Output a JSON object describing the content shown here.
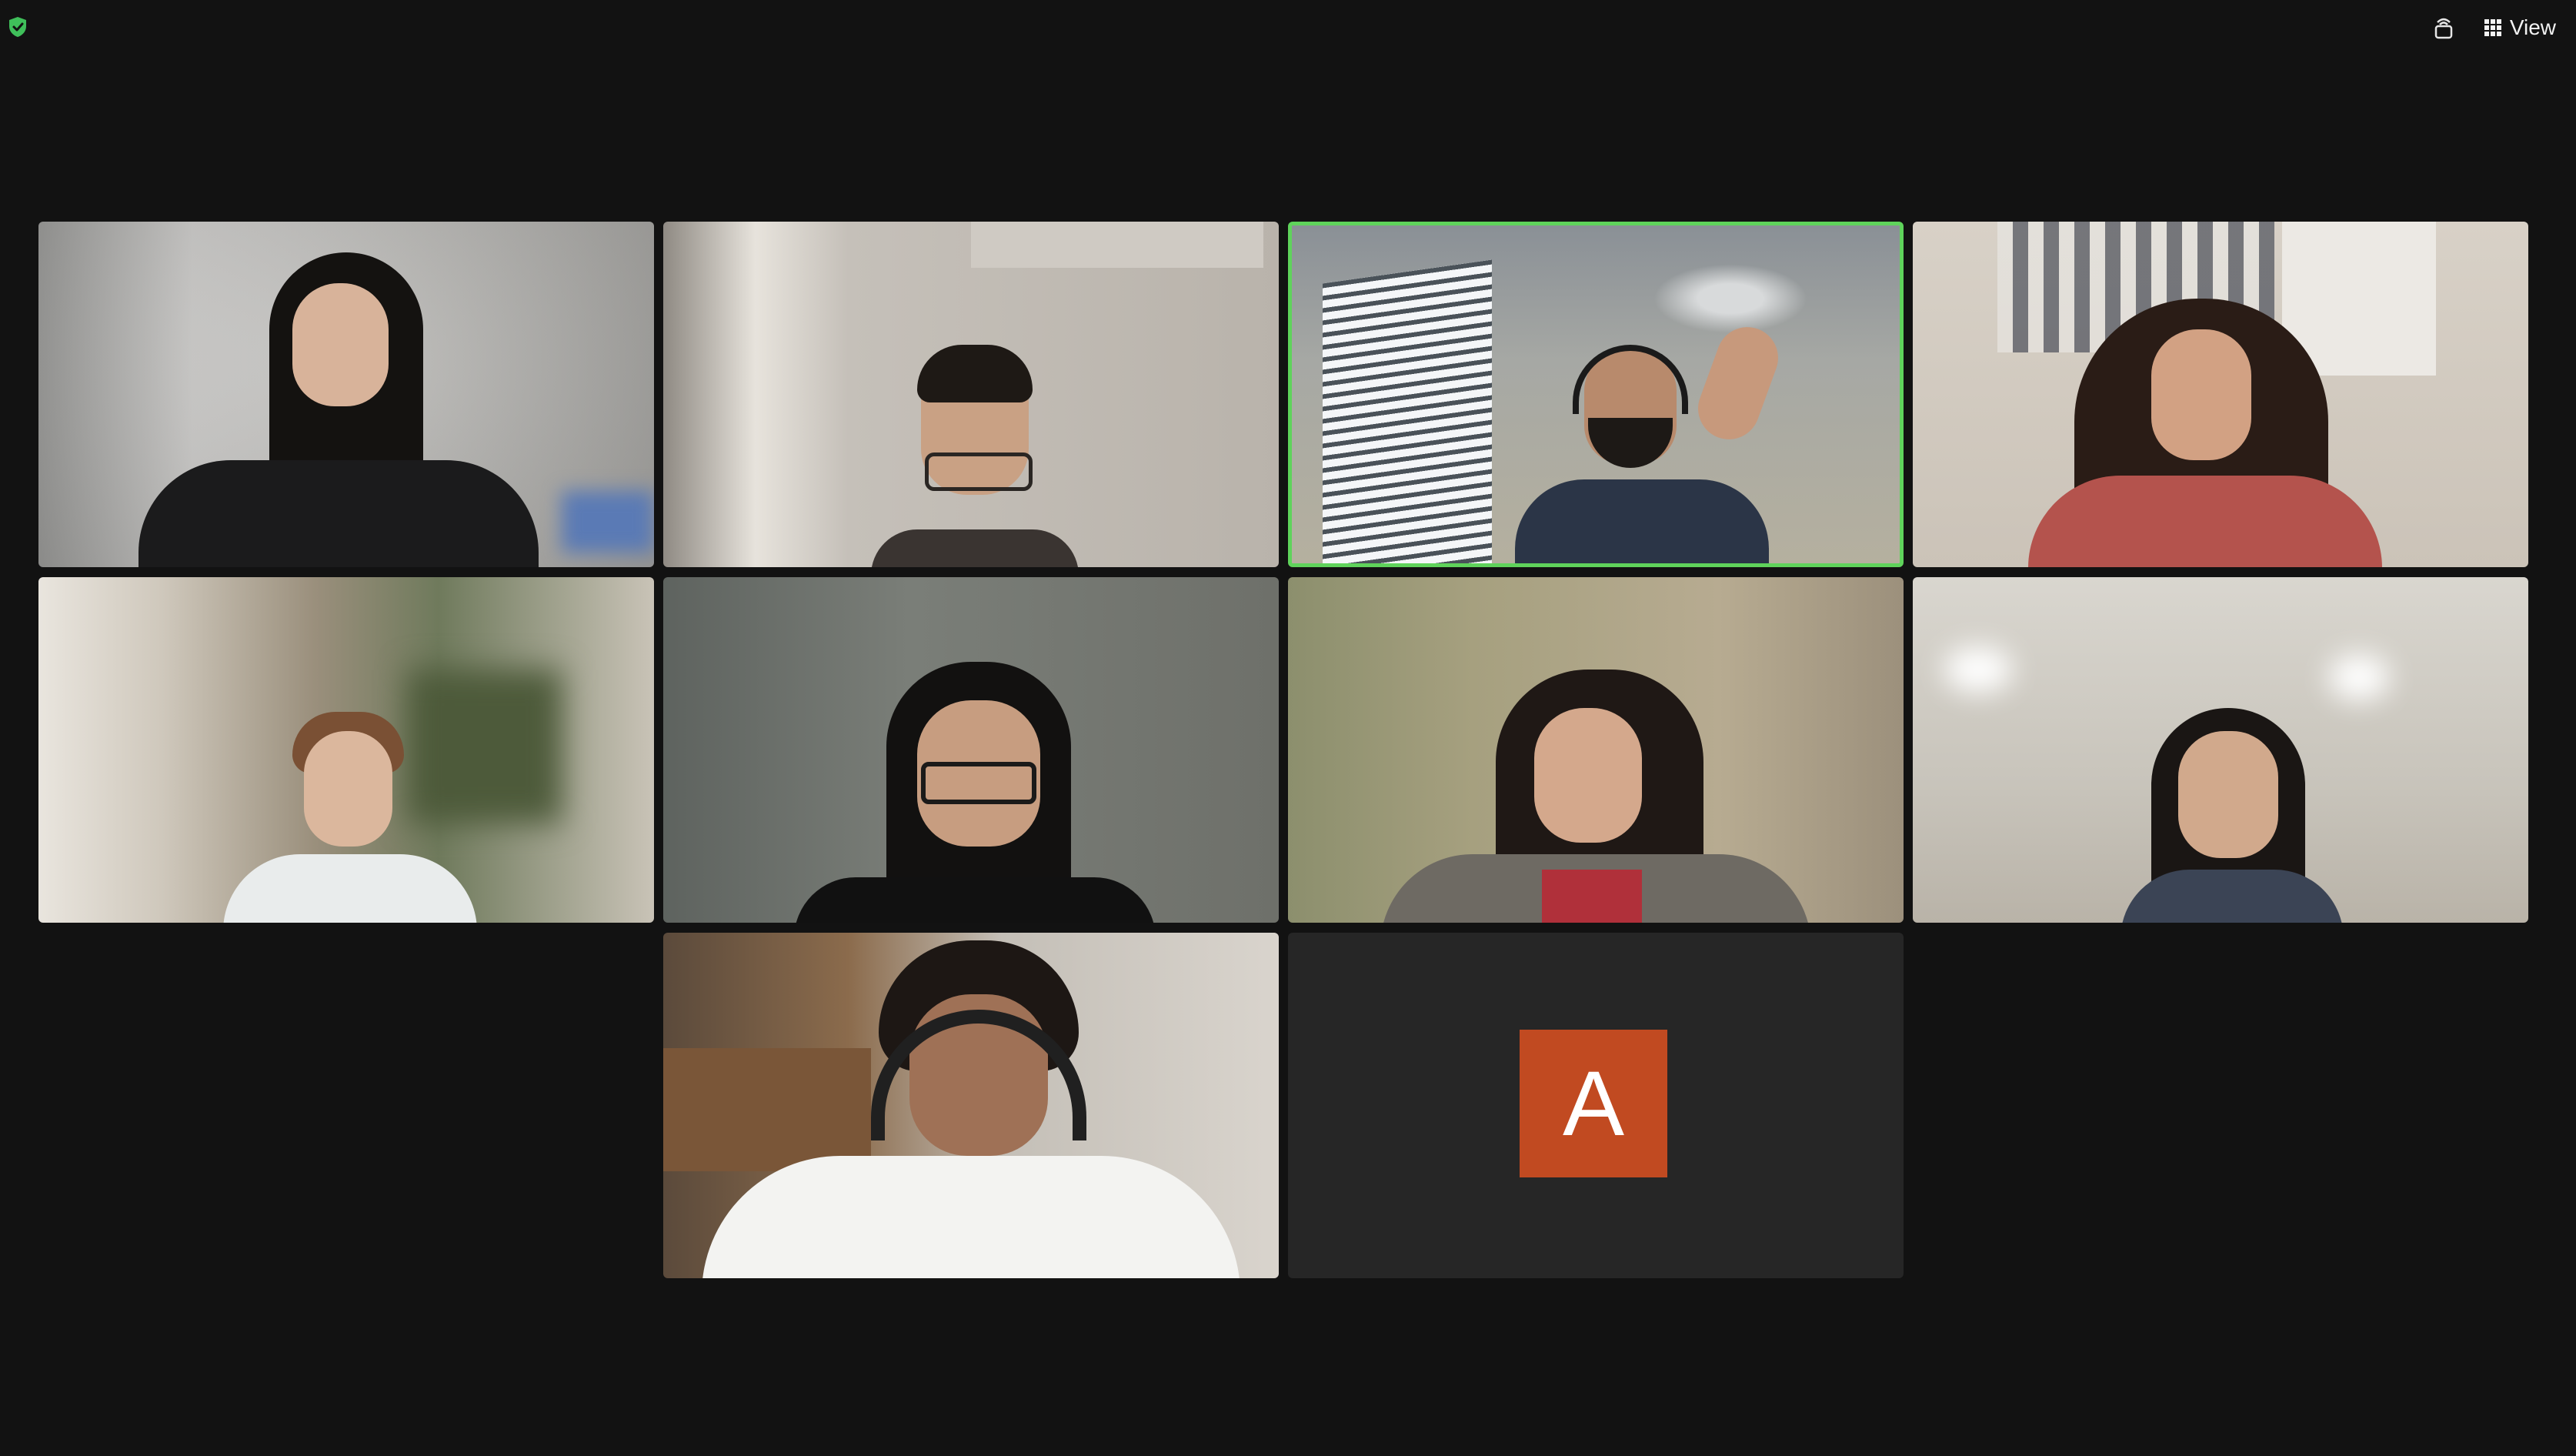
{
  "window": {
    "view_label": "View",
    "icons": {
      "security": "shield-check-icon",
      "immersive": "immersive-view-icon",
      "view": "grid-icon"
    },
    "colors": {
      "background": "#121212",
      "speaker_border": "#5fd35b",
      "avatar_bg": "#c14a21"
    }
  },
  "participants": [
    {
      "id": "p1",
      "video": true
    },
    {
      "id": "p2",
      "video": true
    },
    {
      "id": "p3",
      "video": true,
      "active_speaker": true
    },
    {
      "id": "p4",
      "video": true
    },
    {
      "id": "p5",
      "video": true
    },
    {
      "id": "p6",
      "video": true
    },
    {
      "id": "p7",
      "video": true
    },
    {
      "id": "p8",
      "video": true
    },
    {
      "id": "p9",
      "video": true
    },
    {
      "id": "p10",
      "video": false,
      "avatar_letter": "A"
    }
  ]
}
